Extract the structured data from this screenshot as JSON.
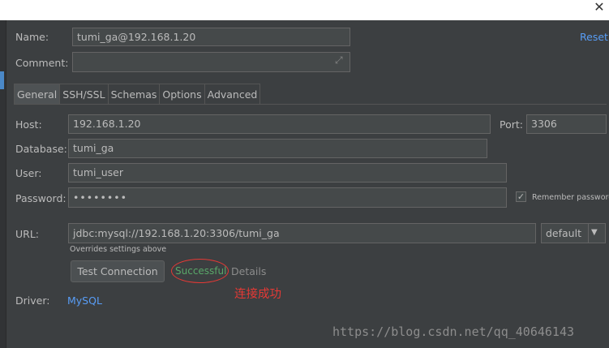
{
  "window": {
    "close_glyph": "✕"
  },
  "name": {
    "label": "Name:",
    "value": "tumi_ga@192.168.1.20"
  },
  "reset_label": "Reset",
  "comment": {
    "label": "Comment:",
    "value": "",
    "expand_glyph": "⤢"
  },
  "tabs": [
    {
      "label": "General",
      "active": true
    },
    {
      "label": "SSH/SSL"
    },
    {
      "label": "Schemas"
    },
    {
      "label": "Options"
    },
    {
      "label": "Advanced"
    }
  ],
  "host": {
    "label": "Host:",
    "value": "192.168.1.20"
  },
  "port": {
    "label": "Port:",
    "value": "3306"
  },
  "database": {
    "label": "Database:",
    "value": "tumi_ga"
  },
  "user": {
    "label": "User:",
    "value": "tumi_user"
  },
  "password": {
    "label": "Password:",
    "value": "••••••••"
  },
  "remember": {
    "label": "Remember password",
    "checked": true,
    "check_glyph": "✓"
  },
  "url": {
    "label": "URL:",
    "value": "jdbc:mysql://192.168.1.20:3306/tumi_ga",
    "hint": "Overrides settings above"
  },
  "url_mode": {
    "value": "default",
    "arrow_glyph": "▼"
  },
  "test_connection": {
    "label": "Test Connection"
  },
  "status": {
    "text": "Successful",
    "color": "#59a869",
    "annotation_color": "#e53935"
  },
  "details_label": "Details",
  "annotation_text": "连接成功",
  "driver": {
    "label": "Driver:",
    "value": "MySQL"
  },
  "watermark": "https://blog.csdn.net/qq_40646143",
  "colors": {
    "background": "#3c3f41",
    "accent": "#589df6",
    "field": "#45494a"
  }
}
